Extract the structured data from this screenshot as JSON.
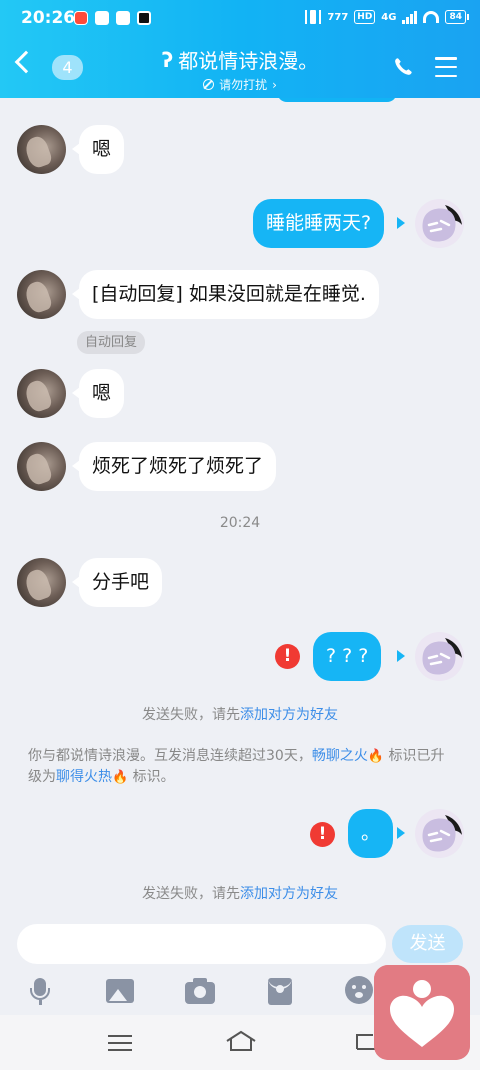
{
  "status_bar": {
    "time": "20:26",
    "network": "4G",
    "hd": "HD",
    "battery": "84"
  },
  "header": {
    "unread_count": "4",
    "title": "都说情诗浪漫。",
    "subtitle": "请勿打扰",
    "subtitle_arrow": "›"
  },
  "messages": [
    {
      "from": "other",
      "text": "嗯"
    },
    {
      "from": "self",
      "text": "睡能睡两天?"
    },
    {
      "from": "other",
      "text": "[自动回复] 如果没回就是在睡觉.",
      "tag": "自动回复"
    },
    {
      "from": "other",
      "text": "嗯"
    },
    {
      "from": "other",
      "text": "烦死了烦死了烦死了"
    },
    {
      "from": "other",
      "text": "分手吧"
    },
    {
      "from": "self",
      "text": "? ? ?",
      "failed": true
    },
    {
      "from": "self",
      "text": "。",
      "failed": true
    }
  ],
  "timestamp": "20:24",
  "fail_icon": "!",
  "send_fail": {
    "prefix": "发送失败，请先",
    "link": "添加对方为好友"
  },
  "notice": {
    "part1": "你与都说情诗浪漫。互发消息连续超过30天，",
    "badge1": "畅聊之火",
    "part2": "标识已升级为",
    "badge2": "聊得火热",
    "part3": "标识。"
  },
  "input": {
    "placeholder": "",
    "send_label": "发送"
  },
  "toolbar_icons": [
    "mic-icon",
    "image-icon",
    "camera-icon",
    "red-packet-icon",
    "emoji-icon"
  ],
  "colors": {
    "accent": "#12b3f4",
    "bubble_out": "#16b5f5",
    "fail_red": "#f03a33",
    "link": "#3d8ee8"
  }
}
